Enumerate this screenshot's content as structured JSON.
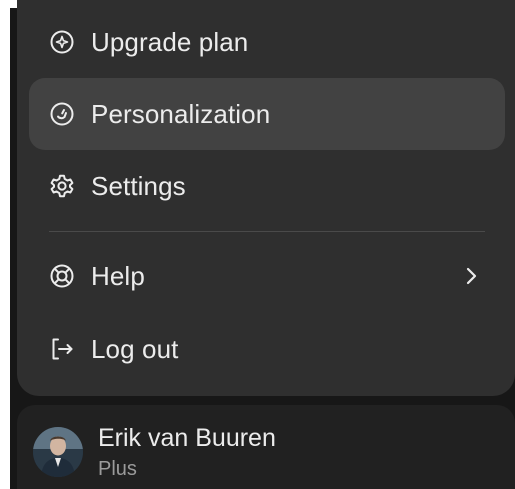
{
  "menu": {
    "items": [
      {
        "label": "Upgrade plan",
        "icon": "upgrade-sparkle-icon"
      },
      {
        "label": "Personalization",
        "icon": "personalization-icon",
        "active": true
      },
      {
        "label": "Settings",
        "icon": "gear-icon"
      },
      {
        "label": "Help",
        "icon": "lifebuoy-icon",
        "has_submenu": true
      },
      {
        "label": "Log out",
        "icon": "logout-icon"
      }
    ]
  },
  "user": {
    "name": "Erik van Buuren",
    "plan": "Plus",
    "avatar": "user-avatar"
  },
  "colors": {
    "menu_bg": "#2f2f2f",
    "active_item_bg": "#424242",
    "sidebar_bg": "#171717",
    "user_card_bg": "#212121",
    "text": "#ececec",
    "muted_text": "#9b9b9b"
  }
}
